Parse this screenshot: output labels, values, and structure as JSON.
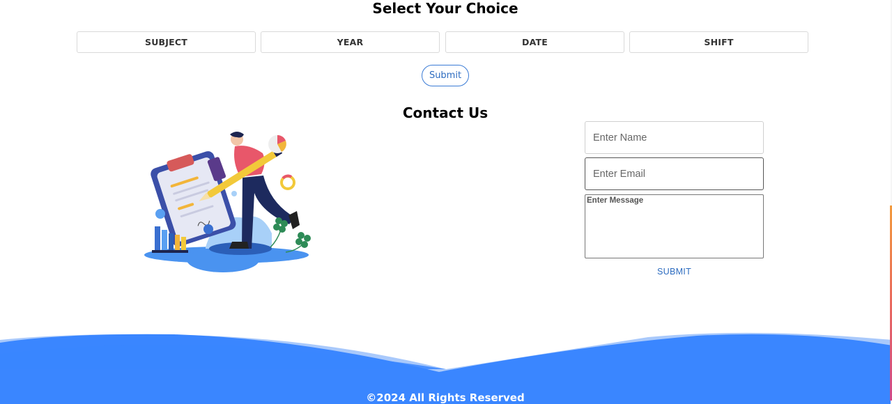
{
  "choice_section": {
    "title": "Select Your Choice",
    "options": [
      "SUBJECT",
      "YEAR",
      "DATE",
      "SHIFT"
    ],
    "submit_label": "Submit"
  },
  "contact_section": {
    "title": "Contact Us",
    "name_placeholder": "Enter Name",
    "email_placeholder": "Enter Email",
    "message_placeholder": "Enter Message",
    "submit_label": "SUBMIT"
  },
  "footer": {
    "copyright": "©2024 All Rights Reserved"
  },
  "colors": {
    "accent_blue": "#3a86ff",
    "link_blue": "#2d6cc0",
    "scrollbar_gradient": [
      "#f29a3c",
      "#d04a8a"
    ]
  },
  "icons": {
    "illustration": "person-with-pencil-and-clipboard-illustration"
  }
}
